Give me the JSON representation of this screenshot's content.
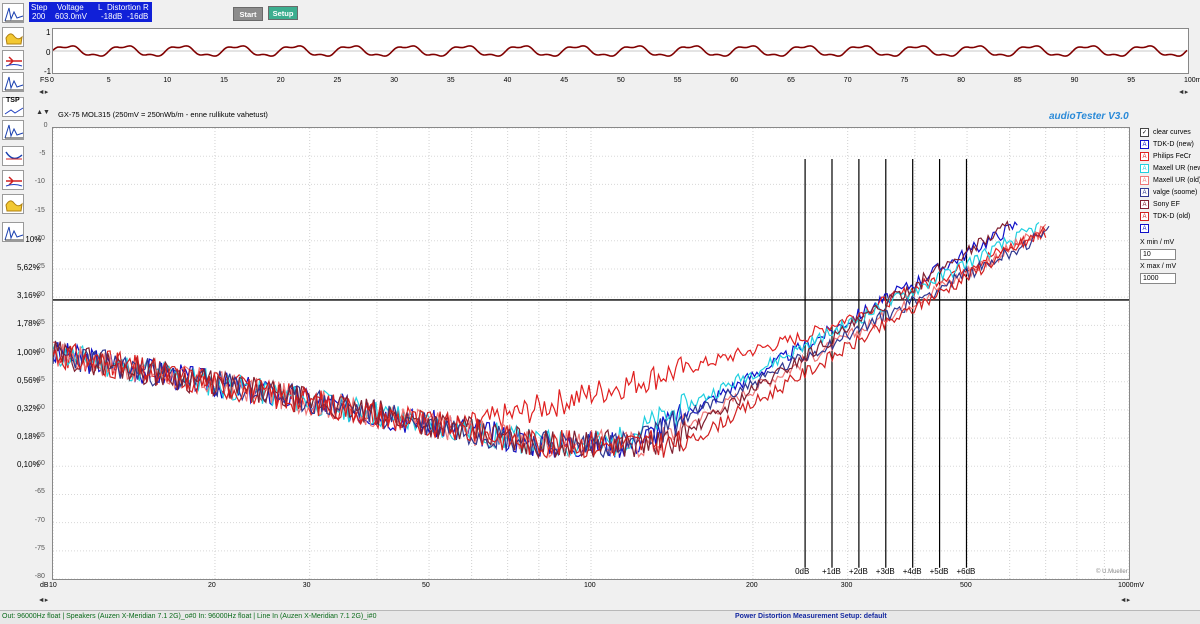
{
  "status": {
    "step_label": "Step",
    "step_value": "200",
    "voltage_label": "Voltage",
    "voltage_value": "603.0mV",
    "l_label": "L",
    "distortion_label": "Distortion",
    "r_label": "R",
    "l_value": "-18dB",
    "r_value": "-16dB"
  },
  "buttons": {
    "start": "Start",
    "setup": "Setup"
  },
  "left_tools": [
    "scope-icon",
    "spectrum-icon",
    "distortion-icon",
    "sweep-icon",
    "tsp-icon",
    "impulse-icon",
    "response-icon",
    "level-icon",
    "filter-icon",
    "meter-icon",
    "curve-icon"
  ],
  "tsp_label": "TSP",
  "scope": {
    "y_ticks": [
      "1",
      "0",
      "-1"
    ],
    "x_start_label": "FS",
    "x_ticks": [
      "0",
      "5",
      "10",
      "15",
      "20",
      "25",
      "30",
      "35",
      "40",
      "45",
      "50",
      "55",
      "60",
      "65",
      "70",
      "75",
      "80",
      "85",
      "90",
      "95",
      "100ms"
    ]
  },
  "graph": {
    "title": "GX-75 MOL315 (250mV = 250nWb/m - enne rullikute vahetust)",
    "app_name": "audioTester  V3.0",
    "credit": "© U.Mueller",
    "db_ticks": [
      "0",
      "-5",
      "-10",
      "-15",
      "-20",
      "-25",
      "-30",
      "-35",
      "-40",
      "-45",
      "-50",
      "-55",
      "-60",
      "-65",
      "-70",
      "-75",
      "-80"
    ],
    "pct_ticks": [
      "10%",
      "5,62%",
      "3,16%",
      "1,78%",
      "1,00%",
      "0,56%",
      "0,32%",
      "0,18%",
      "0,10%"
    ],
    "x_unit": "dB",
    "x_ticks": [
      "10",
      "20",
      "30",
      "50",
      "100",
      "200",
      "300",
      "500",
      "1000mV"
    ],
    "marker_labels": [
      "0dB",
      "+1dB",
      "+2dB",
      "+3dB",
      "+4dB",
      "+5dB",
      "+6dB"
    ]
  },
  "legend": {
    "clear_label": "clear curves",
    "items": [
      {
        "label": "TDK-D (new)",
        "color": "#1010c8",
        "mark": "A"
      },
      {
        "label": "Philips FeCr",
        "color": "#e02020",
        "mark": "A"
      },
      {
        "label": "Maxell UR (new)",
        "color": "#20d0e0",
        "mark": "A"
      },
      {
        "label": "Maxell UR (old)",
        "color": "#f07878",
        "mark": "A"
      },
      {
        "label": "valge (soome)",
        "color": "#303890",
        "mark": "A"
      },
      {
        "label": "Sony EF",
        "color": "#802030",
        "mark": "A"
      },
      {
        "label": "TDK-D (old)",
        "color": "#d02020",
        "mark": "A"
      },
      {
        "label": "",
        "color": "#1010c8",
        "mark": "A"
      }
    ],
    "xmin_label": "X min / mV",
    "xmin_value": "10",
    "xmax_label": "X max / mV",
    "xmax_value": "1000"
  },
  "status_bar": {
    "left": "Out: 96000Hz float  |  Speakers (Auzen X-Meridian 7.1 2G)_o#0  In: 96000Hz float  |  Line In (Auzen X-Meridian 7.1 2G)_i#0",
    "right": "Power Distortion Measurement Setup:  default"
  },
  "colors": {
    "status_bg": "#1020d8",
    "setup_btn": "#3cae8f",
    "app_title": "#2a8ad8",
    "scope_trace": "#800000"
  }
}
